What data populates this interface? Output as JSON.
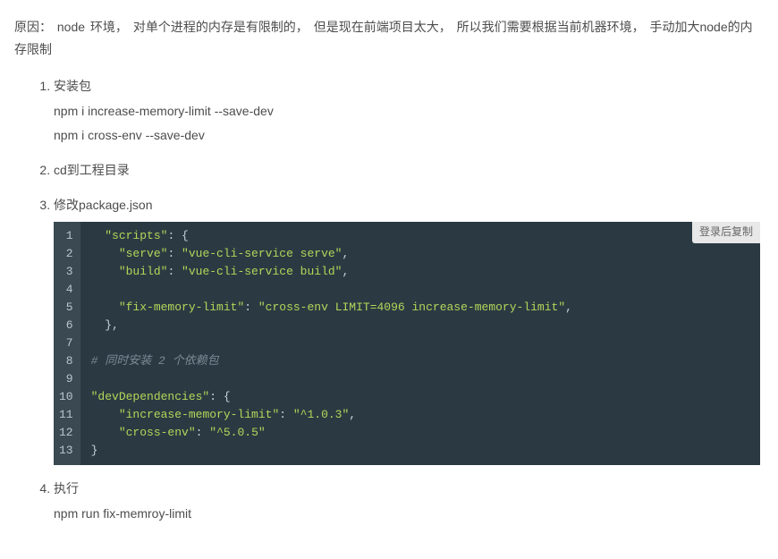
{
  "intro": "原因： node 环境， 对单个进程的内存是有限制的， 但是现在前端项目太大， 所以我们需要根据当前机器环境， 手动加大node的内存限制",
  "steps": [
    {
      "title": "安装包",
      "lines": [
        "npm i increase-memory-limit --save-dev",
        "npm i cross-env --save-dev"
      ]
    },
    {
      "title": "cd到工程目录",
      "lines": []
    },
    {
      "title": "修改package.json",
      "lines": [],
      "code": {
        "copy_label": "登录后复制",
        "lines": [
          {
            "indent": 2,
            "segments": [
              {
                "t": "\"scripts\"",
                "c": "tok-key"
              },
              {
                "t": ": {",
                "c": "tok-punc"
              }
            ]
          },
          {
            "indent": 4,
            "segments": [
              {
                "t": "\"serve\"",
                "c": "tok-key"
              },
              {
                "t": ": ",
                "c": "tok-punc"
              },
              {
                "t": "\"vue-cli-service serve\"",
                "c": "tok-str"
              },
              {
                "t": ",",
                "c": "tok-punc"
              }
            ]
          },
          {
            "indent": 4,
            "segments": [
              {
                "t": "\"build\"",
                "c": "tok-key"
              },
              {
                "t": ": ",
                "c": "tok-punc"
              },
              {
                "t": "\"vue-cli-service build\"",
                "c": "tok-str"
              },
              {
                "t": ",",
                "c": "tok-punc"
              }
            ]
          },
          {
            "indent": 0,
            "segments": []
          },
          {
            "indent": 4,
            "segments": [
              {
                "t": "\"fix-memory-limit\"",
                "c": "tok-key"
              },
              {
                "t": ": ",
                "c": "tok-punc"
              },
              {
                "t": "\"cross-env LIMIT=4096 increase-memory-limit\"",
                "c": "tok-str"
              },
              {
                "t": ",",
                "c": "tok-punc"
              }
            ]
          },
          {
            "indent": 2,
            "segments": [
              {
                "t": "},",
                "c": "tok-punc"
              }
            ]
          },
          {
            "indent": 0,
            "segments": []
          },
          {
            "indent": 0,
            "segments": [
              {
                "t": "# 同时安装 2 个依赖包",
                "c": "tok-comment"
              }
            ]
          },
          {
            "indent": 0,
            "segments": []
          },
          {
            "indent": 0,
            "segments": [
              {
                "t": "\"devDependencies\"",
                "c": "tok-key"
              },
              {
                "t": ": {",
                "c": "tok-punc"
              }
            ]
          },
          {
            "indent": 4,
            "segments": [
              {
                "t": "\"increase-memory-limit\"",
                "c": "tok-key"
              },
              {
                "t": ": ",
                "c": "tok-punc"
              },
              {
                "t": "\"^1.0.3\"",
                "c": "tok-str"
              },
              {
                "t": ",",
                "c": "tok-punc"
              }
            ]
          },
          {
            "indent": 4,
            "segments": [
              {
                "t": "\"cross-env\"",
                "c": "tok-key"
              },
              {
                "t": ": ",
                "c": "tok-punc"
              },
              {
                "t": "\"^5.0.5\"",
                "c": "tok-str"
              }
            ]
          },
          {
            "indent": 0,
            "segments": [
              {
                "t": "}",
                "c": "tok-punc"
              }
            ]
          }
        ]
      }
    },
    {
      "title": "执行",
      "lines": [
        "npm run fix-memroy-limit"
      ]
    }
  ]
}
